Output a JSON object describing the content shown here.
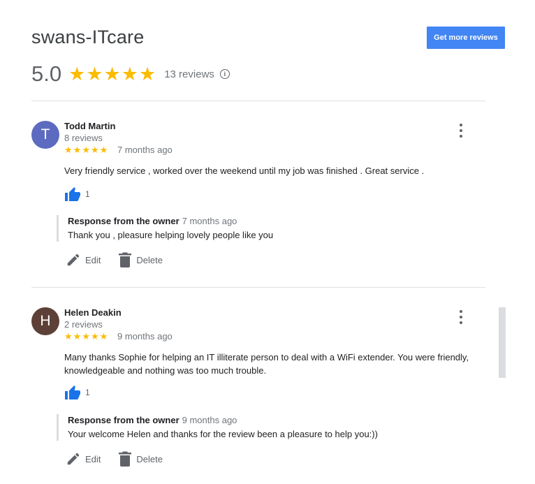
{
  "business": {
    "name": "swans-ITcare",
    "get_more_label": "Get more reviews",
    "rating": "5.0",
    "stars": 5,
    "review_count_label": "13 reviews",
    "info_glyph": "i"
  },
  "colors": {
    "star": "#fbbc04",
    "accent": "#4285f4",
    "like": "#1a73e8",
    "avatar_todd": "#5c6bc0",
    "avatar_helen": "#5d4037"
  },
  "reviews": [
    {
      "avatar_letter": "T",
      "name": "Todd Martin",
      "reviewer_reviews": "8 reviews",
      "stars": 5,
      "time": "7 months ago",
      "text": "Very friendly service , worked over the weekend until my job was finished . Great service .",
      "likes": "1",
      "owner_label": "Response from the owner",
      "owner_time": "7 months ago",
      "owner_text": "Thank you , pleasure helping lovely people like you",
      "edit_label": "Edit",
      "delete_label": "Delete"
    },
    {
      "avatar_letter": "H",
      "name": "Helen Deakin",
      "reviewer_reviews": "2 reviews",
      "stars": 5,
      "time": "9 months ago",
      "text": "Many thanks Sophie for helping an IT illiterate person to deal with a WiFi extender. You were friendly, knowledgeable and nothing was too much trouble.",
      "likes": "1",
      "owner_label": "Response from the owner",
      "owner_time": "9 months ago",
      "owner_text": "Your welcome Helen and thanks for the review been a pleasure to help you:))",
      "edit_label": "Edit",
      "delete_label": "Delete"
    }
  ],
  "icons": {
    "star": "star-icon",
    "menu": "more-vert-icon",
    "like": "thumb-up-icon",
    "edit": "pencil-icon",
    "delete": "trash-icon",
    "info": "info-icon"
  }
}
